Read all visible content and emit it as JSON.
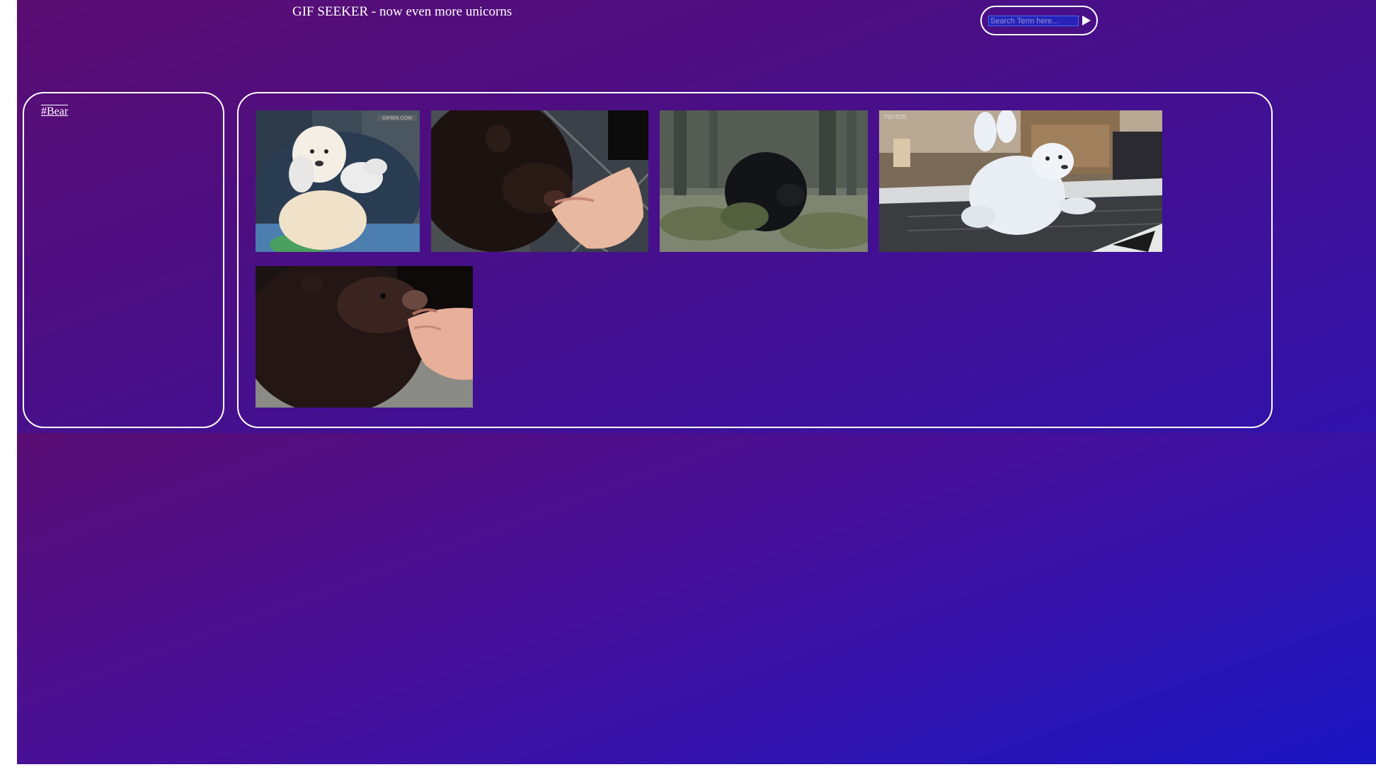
{
  "header": {
    "title": "GIF SEEKER - now even more unicorns"
  },
  "search": {
    "placeholder": "Search Term here...",
    "submit_icon": "play-triangle-icon"
  },
  "tags": {
    "items": [
      {
        "label": "#Bear"
      }
    ]
  },
  "results": {
    "gifs": [
      {
        "name": "gif-polar-bear-cub-gloved-hands",
        "watermark": "GIFBIN.COM"
      },
      {
        "name": "gif-black-bear-cub-licking-hand"
      },
      {
        "name": "gif-black-bear-in-forest"
      },
      {
        "name": "gif-polar-bear-cub-on-back",
        "watermark": "TSOTOS"
      },
      {
        "name": "gif-black-bear-cub-eating-from-hand"
      }
    ]
  },
  "colors": {
    "gradient_start": "#5b0d72",
    "gradient_end": "#1a14c0",
    "panel_border": "#ffffff",
    "text": "#ffffff"
  }
}
